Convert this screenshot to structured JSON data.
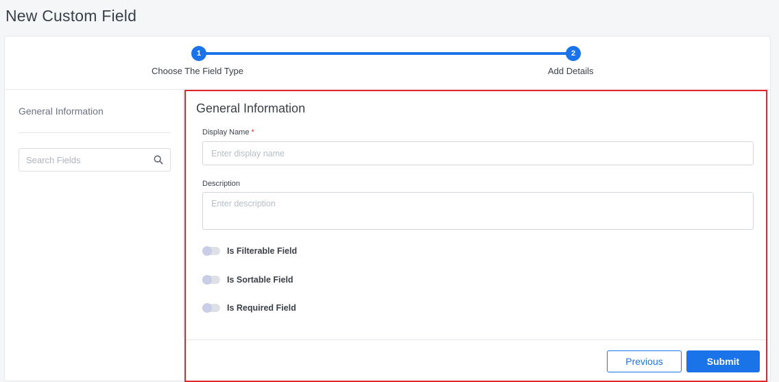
{
  "page": {
    "title": "New Custom Field"
  },
  "stepper": {
    "steps": [
      {
        "number": "1",
        "label": "Choose The Field Type"
      },
      {
        "number": "2",
        "label": "Add Details"
      }
    ]
  },
  "sidebar": {
    "heading": "General Information",
    "search": {
      "placeholder": "Search Fields",
      "value": ""
    }
  },
  "form": {
    "heading": "General Information",
    "display_name": {
      "label": "Display Name",
      "required_mark": "*",
      "placeholder": "Enter display name",
      "value": ""
    },
    "description": {
      "label": "Description",
      "placeholder": "Enter description",
      "value": ""
    },
    "toggles": [
      {
        "label": "Is Filterable Field",
        "checked": false
      },
      {
        "label": "Is Sortable Field",
        "checked": false
      },
      {
        "label": "Is Required Field",
        "checked": false
      }
    ],
    "buttons": {
      "previous": "Previous",
      "submit": "Submit"
    }
  },
  "colors": {
    "accent": "#1a73e8",
    "highlight_border": "#e5252a",
    "required": "#e5252a"
  },
  "icons": {
    "search": "search-icon"
  }
}
